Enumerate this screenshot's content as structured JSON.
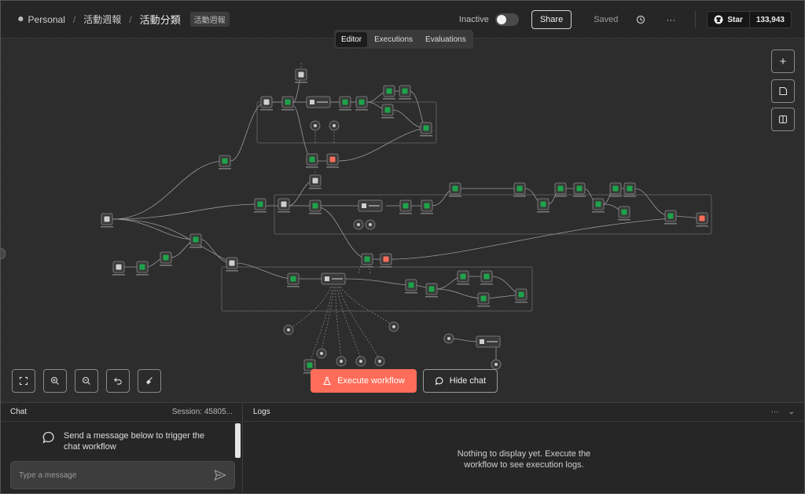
{
  "header": {
    "breadcrumb": [
      "Personal",
      "活動週報",
      "活動分類"
    ],
    "tag": "活動週報",
    "status_label": "Inactive",
    "share_label": "Share",
    "saved_label": "Saved",
    "github_star_label": "Star",
    "github_star_count": "133,943"
  },
  "tabs": [
    "Editor",
    "Executions",
    "Evaluations"
  ],
  "canvas": {
    "execute_label": "Execute workflow",
    "hide_chat_label": "Hide chat",
    "accent_color": "#ff6d5a",
    "node_green": "#1fa34a"
  },
  "chat": {
    "title": "Chat",
    "session": "Session: 45805...",
    "hint": "Send a message below to trigger the chat workflow",
    "placeholder": "Type a message"
  },
  "logs": {
    "title": "Logs",
    "empty": "Nothing to display yet. Execute the workflow to see execution logs."
  }
}
